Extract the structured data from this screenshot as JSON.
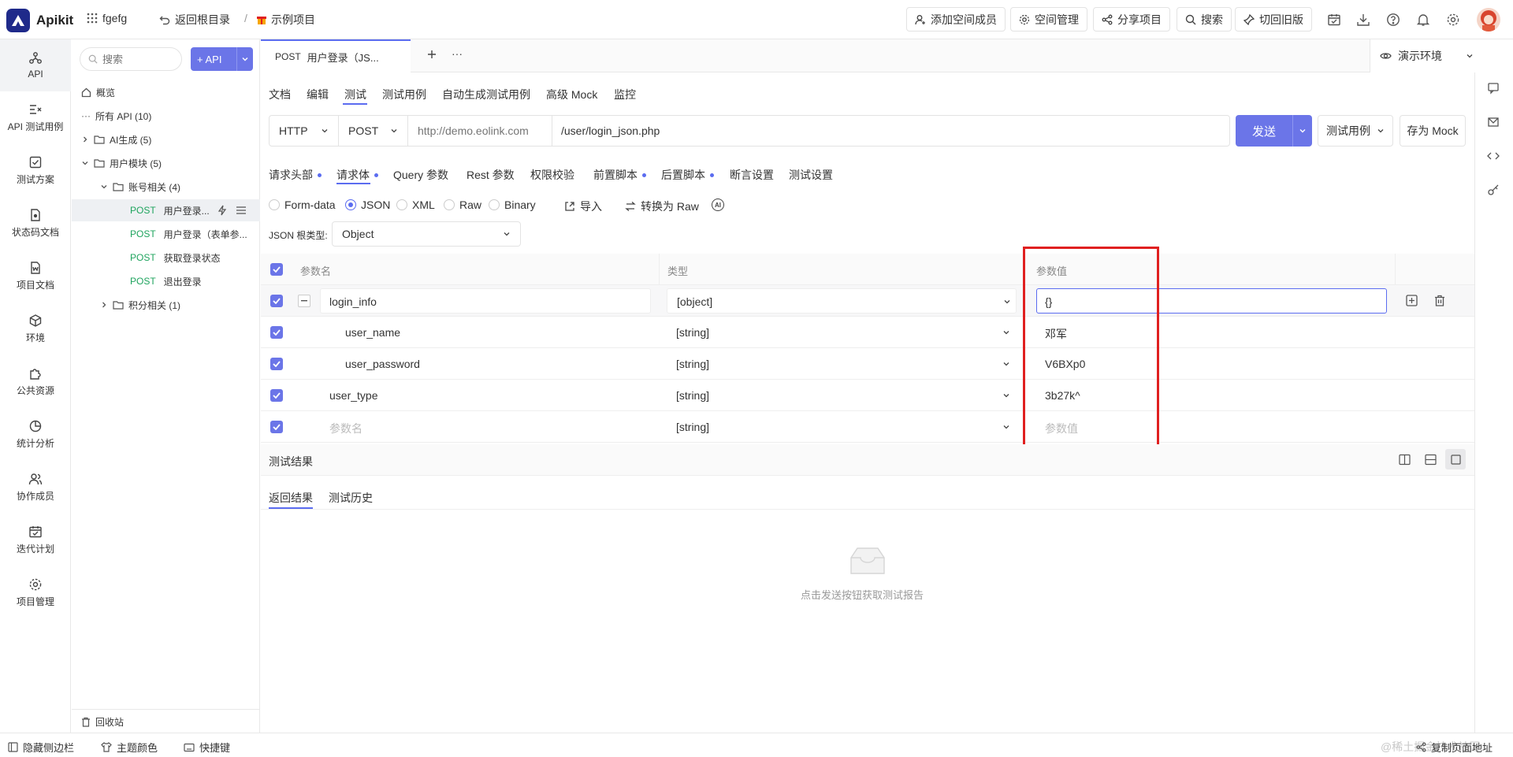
{
  "app": {
    "name": "Apikit"
  },
  "topbar": {
    "workspace": "fgefg",
    "back_root": "返回根目录",
    "sep": "/",
    "project": "示例项目",
    "add_member": "添加空间成员",
    "space_manage": "空间管理",
    "share_project": "分享项目",
    "search": "搜索",
    "switch_old": "切回旧版"
  },
  "leftnav": {
    "items": [
      {
        "label": "API"
      },
      {
        "label": "API 测试用例"
      },
      {
        "label": "测试方案"
      },
      {
        "label": "状态码文档"
      },
      {
        "label": "项目文档"
      },
      {
        "label": "环境"
      },
      {
        "label": "公共资源"
      },
      {
        "label": "统计分析"
      },
      {
        "label": "协作成员"
      },
      {
        "label": "迭代计划"
      },
      {
        "label": "项目管理"
      }
    ]
  },
  "tree": {
    "search_placeholder": "搜索",
    "add_api": "+ API",
    "overview": "概览",
    "all_api": "所有 API (10)",
    "ai_group": "AI生成 (5)",
    "user_module": "用户模块 (5)",
    "account_group": "账号相关 (4)",
    "apis": [
      {
        "method": "POST",
        "name": "用户登录..."
      },
      {
        "method": "POST",
        "name": "用户登录（表单参..."
      },
      {
        "method": "POST",
        "name": "获取登录状态"
      },
      {
        "method": "POST",
        "name": "退出登录"
      }
    ],
    "points_group": "积分相关 (1)",
    "recycle": "回收站"
  },
  "tab": {
    "method": "POST",
    "title": "用户登录（JS..."
  },
  "env": {
    "label": "演示环境"
  },
  "subtabs": [
    "文档",
    "编辑",
    "测试",
    "测试用例",
    "自动生成测试用例",
    "高级 Mock",
    "监控"
  ],
  "request": {
    "protocol": "HTTP",
    "method": "POST",
    "host_placeholder": "http://demo.eolink.com",
    "path": "/user/login_json.php",
    "send": "发送",
    "test_case": "测试用例",
    "save_mock": "存为 Mock"
  },
  "bodytabs": [
    {
      "label": "请求头部",
      "dot": true
    },
    {
      "label": "请求体",
      "dot": true
    },
    {
      "label": "Query 参数",
      "dot": false
    },
    {
      "label": "Rest 参数",
      "dot": false
    },
    {
      "label": "权限校验",
      "dot": false
    },
    {
      "label": "前置脚本",
      "dot": true
    },
    {
      "label": "后置脚本",
      "dot": true
    },
    {
      "label": "断言设置",
      "dot": false
    },
    {
      "label": "测试设置",
      "dot": false
    }
  ],
  "formats": {
    "form_data": "Form-data",
    "json": "JSON",
    "xml": "XML",
    "raw": "Raw",
    "binary": "Binary",
    "import": "导入",
    "convert_raw": "转换为 Raw"
  },
  "json_root": {
    "label": "JSON 根类型:",
    "value": "Object"
  },
  "table": {
    "headers": {
      "name": "参数名",
      "type": "类型",
      "value": "参数值"
    },
    "rows": [
      {
        "name": "login_info",
        "type": "[object]",
        "value": "{}"
      },
      {
        "name": "user_name",
        "type": "[string]",
        "value": "邓军"
      },
      {
        "name": "user_password",
        "type": "[string]",
        "value": "V6BXp0"
      },
      {
        "name": "user_type",
        "type": "[string]",
        "value": "3b27k^"
      },
      {
        "name": "参数名",
        "type": "[string]",
        "value": "参数值"
      }
    ]
  },
  "result": {
    "title": "测试结果",
    "tab_result": "返回结果",
    "tab_history": "测试历史",
    "empty": "点击发送按钮获取测试报告"
  },
  "bottombar": {
    "hide_sidebar": "隐藏侧边栏",
    "theme": "主题颜色",
    "shortcuts": "快捷键",
    "copy_url": "复制页面地址",
    "watermark": "@稀土掘金技术社区"
  },
  "colors": {
    "accent": "#5b6cf0",
    "post": "#1fa45e",
    "highlight": "#e02020"
  }
}
